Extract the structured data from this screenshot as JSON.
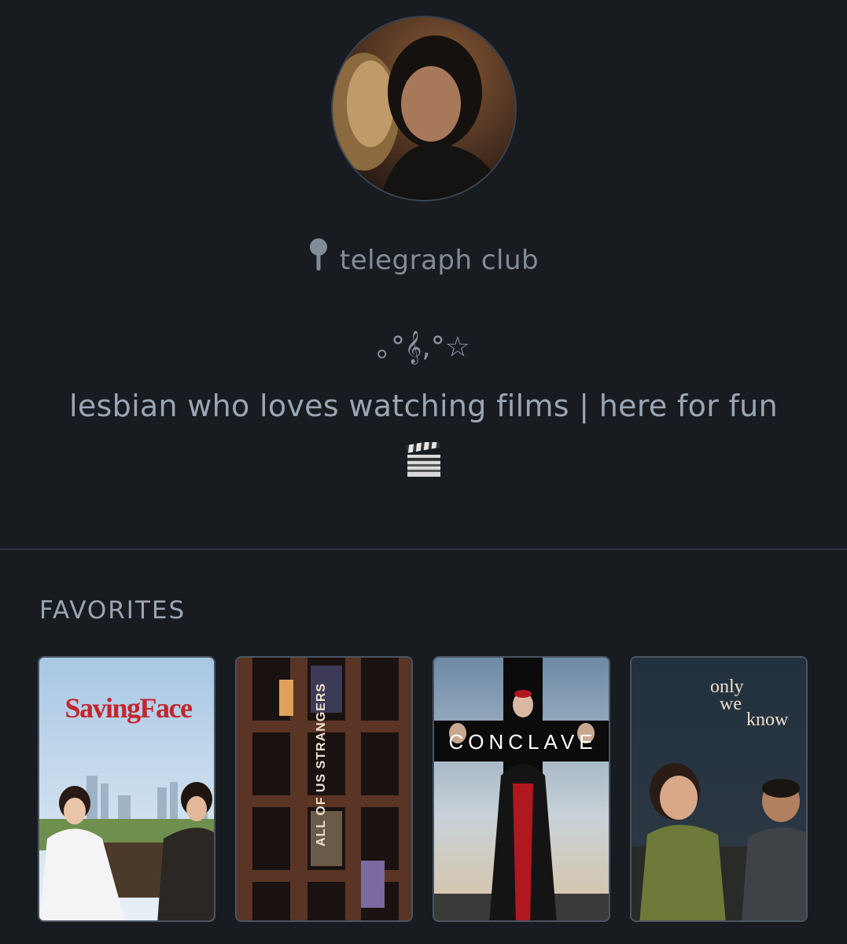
{
  "profile": {
    "avatar_alt": "profile-avatar",
    "location": "telegraph club",
    "decoration": "｡°𝄞,°☆",
    "bio": "lesbian who loves watching films | here for fun"
  },
  "favorites": {
    "title": "FAVORITES",
    "films": [
      {
        "poster_title": "SavingFace"
      },
      {
        "poster_title": "ALL OF US STRANGERS"
      },
      {
        "poster_title": "CONCLAVE"
      },
      {
        "poster_title_line1": "only",
        "poster_title_line2": "we",
        "poster_title_line3": "know"
      }
    ]
  },
  "icons": {
    "location": "location-pin-icon",
    "clapper": "clapper-board-icon"
  }
}
